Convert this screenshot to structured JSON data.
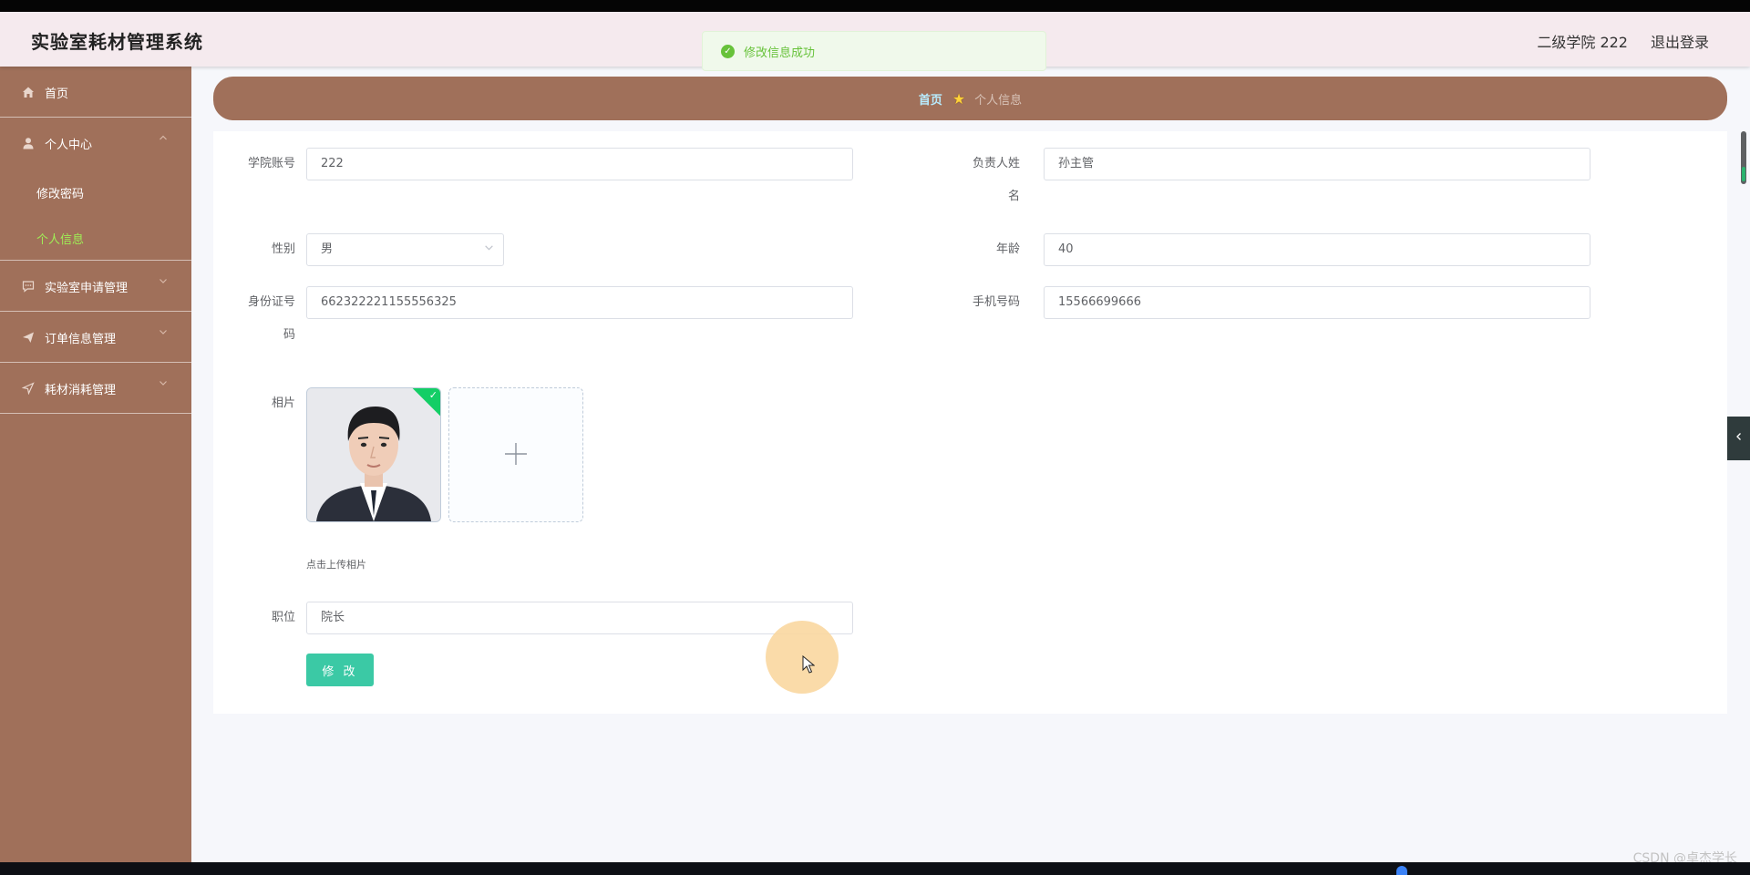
{
  "header": {
    "app_title": "实验室耗材管理系统",
    "user_label": "二级学院 222",
    "logout_label": "退出登录"
  },
  "toast": {
    "message": "修改信息成功"
  },
  "sidebar": {
    "items": [
      {
        "label": "首页",
        "icon": "home-icon"
      },
      {
        "label": "个人中心",
        "icon": "user-icon",
        "expanded": true
      },
      {
        "label": "实验室申请管理",
        "icon": "chat-icon"
      },
      {
        "label": "订单信息管理",
        "icon": "send-icon"
      },
      {
        "label": "耗材消耗管理",
        "icon": "navigation-icon"
      }
    ],
    "personal_submenu": [
      {
        "label": "修改密码"
      },
      {
        "label": "个人信息",
        "active": true
      }
    ]
  },
  "breadcrumb": {
    "home": "首页",
    "current": "个人信息"
  },
  "form": {
    "account": {
      "label": "学院账号",
      "value": "222"
    },
    "manager_name": {
      "label_line1": "负责人姓",
      "label_line2": "名",
      "value": "孙主管"
    },
    "gender": {
      "label": "性别",
      "value": "男"
    },
    "age": {
      "label": "年龄",
      "value": "40"
    },
    "id_card": {
      "label_line1": "身份证号",
      "label_line2": "码",
      "value": "662322221155556325"
    },
    "phone": {
      "label": "手机号码",
      "value": "15566699666"
    },
    "photo": {
      "label": "相片",
      "hint": "点击上传相片"
    },
    "position": {
      "label": "职位",
      "value": "院长"
    },
    "submit_label": "修 改"
  },
  "watermark": "CSDN @卓杰学长",
  "colors": {
    "sidebar_bg": "#a0705a",
    "header_bg": "#f5eaee",
    "active_menu": "#9fef56",
    "success": "#67c23a",
    "primary_button": "#3bc9a5"
  }
}
